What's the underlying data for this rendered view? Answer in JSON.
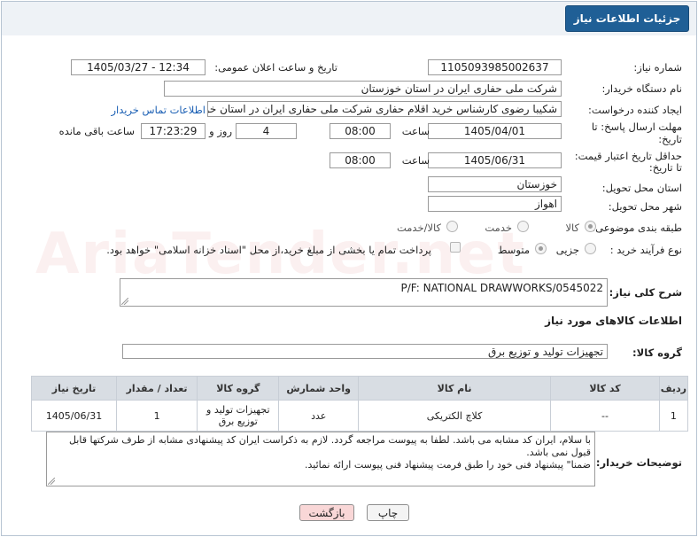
{
  "header": {
    "title": "جزئیات اطلاعات نیاز"
  },
  "fields": {
    "need_number": {
      "label": "شماره نیاز:",
      "value": "1105093985002637"
    },
    "announce_datetime": {
      "label": "تاریخ و ساعت اعلان عمومی:",
      "value": "1405/03/27 - 12:34"
    },
    "buyer_org": {
      "label": "نام دستگاه خریدار:",
      "value": "شرکت ملی حفاری ایران در استان خوزستان"
    },
    "requester": {
      "label": "ایجاد کننده درخواست:",
      "value": "شکیبا رضوی کارشناس خرید اقلام حفاری شرکت ملی حفاری ایران در استان خو",
      "contact_link": "اطلاعات تماس خریدار"
    },
    "reply_deadline": {
      "label_line1": "مهلت ارسال پاسخ: تا",
      "label_line2": "تاریخ:",
      "date": "1405/04/01",
      "time_label": "ساعت",
      "time": "08:00",
      "days": "4",
      "days_label": "روز و",
      "remaining": "17:23:29",
      "remaining_label": "ساعت باقی مانده"
    },
    "price_validity": {
      "label_line1": "حداقل تاریخ اعتبار قیمت:",
      "label_line2": "تا تاریخ:",
      "date": "1405/06/31",
      "time_label": "ساعت",
      "time": "08:00"
    },
    "delivery_province": {
      "label": "استان محل تحویل:",
      "value": "خوزستان"
    },
    "delivery_city": {
      "label": "شهر محل تحویل:",
      "value": "اهواز"
    },
    "category": {
      "label": "طبقه بندی موضوعی:",
      "options": [
        "کالا",
        "خدمت",
        "کالا/خدمت"
      ]
    },
    "process_type": {
      "label": "نوع فرآیند خرید :",
      "options": [
        "جزیی",
        "متوسط"
      ],
      "payment_note": "پرداخت تمام یا بخشی از مبلغ خرید،از محل \"اسناد خزانه اسلامی\" خواهد بود."
    }
  },
  "general_description": {
    "label": "شرح کلی نیاز:",
    "value": "P/F: NATIONAL DRAWWORKS/0545022"
  },
  "goods_info": {
    "title": "اطلاعات کالاهای مورد نیاز"
  },
  "goods_group": {
    "label": "گروه کالا:",
    "value": "تجهیزات تولید و توزیع برق"
  },
  "table": {
    "headers": [
      "ردیف",
      "کد کالا",
      "نام کالا",
      "واحد شمارش",
      "گروه کالا",
      "تعداد / مقدار",
      "تاریخ نیاز"
    ],
    "rows": [
      [
        "1",
        "--",
        "کلاچ الکتریکی",
        "عدد",
        "تجهیزات تولید و توزیع برق",
        "1",
        "1405/06/31"
      ]
    ]
  },
  "buyer_notes": {
    "label": "توضیحات خریدار:",
    "lines": [
      "با سلام، ایران کد مشابه می باشد. لطفا به پیوست مراجعه گردد. لازم به ذکراست ایران کد پیشنهادی مشابه از طرف شرکتها قابل قبول نمی باشد.",
      "ضمنا\" پیشنهاد فنی خود را طبق فرمت پیشنهاد فنی پیوست ارائه نمائید."
    ]
  },
  "buttons": {
    "print": "چاپ",
    "back": "بازگشت"
  },
  "watermark": "AriaTender.net",
  "colors": {
    "header_button": "#1f5f96",
    "link": "#1a5fb4",
    "back_button_bg": "#f9d7d7"
  }
}
